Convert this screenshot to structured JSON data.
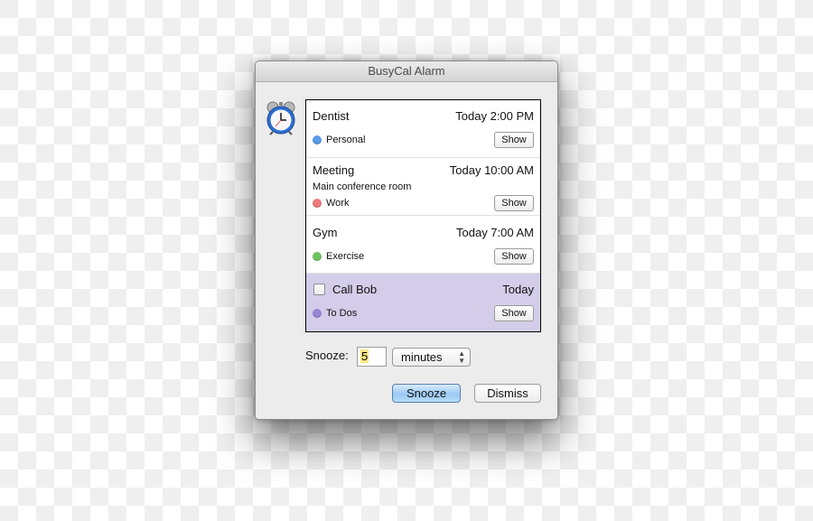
{
  "window": {
    "title": "BusyCal Alarm"
  },
  "icon": "alarm-clock-icon",
  "alarms": [
    {
      "title": "Dentist",
      "time": "Today 2:00 PM",
      "location": "",
      "calendar": "Personal",
      "calendar_color": "#5b9be8",
      "show_label": "Show",
      "is_todo": false
    },
    {
      "title": "Meeting",
      "time": "Today 10:00 AM",
      "location": "Main conference room",
      "calendar": "Work",
      "calendar_color": "#ec7b7b",
      "show_label": "Show",
      "is_todo": false
    },
    {
      "title": "Gym",
      "time": "Today 7:00 AM",
      "location": "",
      "calendar": "Exercise",
      "calendar_color": "#6cc45e",
      "show_label": "Show",
      "is_todo": false
    },
    {
      "title": "Call Bob",
      "time": "Today",
      "location": "",
      "calendar": "To Dos",
      "calendar_color": "#9a85d4",
      "show_label": "Show",
      "is_todo": true,
      "checked": false
    }
  ],
  "snooze": {
    "label": "Snooze:",
    "value": "5",
    "unit": "minutes"
  },
  "buttons": {
    "snooze": "Snooze",
    "dismiss": "Dismiss"
  },
  "colors": {
    "todo_highlight": "#d3cde9",
    "default_button": "#9ccaf4"
  }
}
